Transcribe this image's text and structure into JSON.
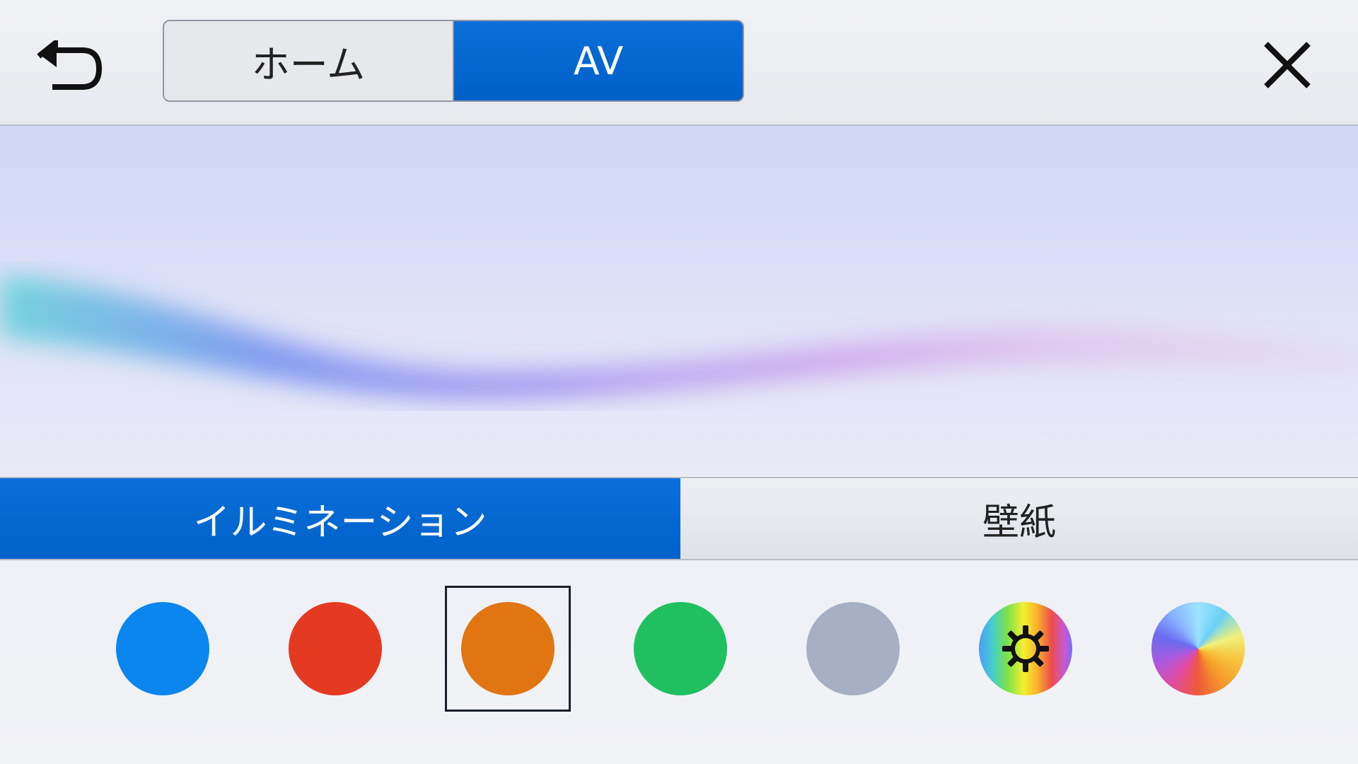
{
  "header": {
    "back_icon": "back-arrow-icon",
    "close_icon": "close-icon",
    "segments": [
      {
        "label": "ホーム",
        "active": false
      },
      {
        "label": "AV",
        "active": true
      }
    ]
  },
  "tabs": [
    {
      "label": "イルミネーション",
      "active": true
    },
    {
      "label": "壁紙",
      "active": false
    }
  ],
  "colors": {
    "selected_index": 2,
    "swatches": [
      {
        "name": "blue",
        "color": "#0a86ee"
      },
      {
        "name": "red",
        "color": "#e43a22"
      },
      {
        "name": "orange",
        "color": "#e07512"
      },
      {
        "name": "green",
        "color": "#20c060"
      },
      {
        "name": "gray",
        "color": "#a6b0c2"
      },
      {
        "name": "custom-rainbow",
        "icon": "gear-icon"
      },
      {
        "name": "color-wheel",
        "icon": "color-wheel-icon"
      }
    ]
  },
  "theme": {
    "accent": "#0066cc",
    "header_bg": "#eceef2"
  }
}
